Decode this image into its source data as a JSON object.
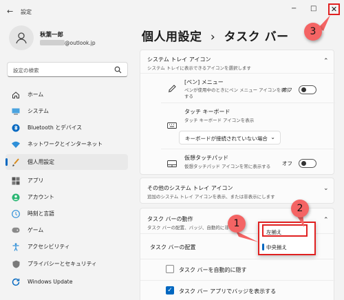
{
  "window": {
    "title": "設定",
    "back_glyph": "←",
    "minimize_glyph": "−",
    "maximize_glyph": "□",
    "close_glyph": "✕"
  },
  "profile": {
    "name": "秋葉一郎",
    "email_suffix": "@outlook.jp"
  },
  "search": {
    "placeholder": "設定の検索"
  },
  "nav": [
    {
      "label": "ホーム",
      "icon": "home-icon"
    },
    {
      "label": "システム",
      "icon": "system-icon"
    },
    {
      "label": "Bluetooth とデバイス",
      "icon": "bluetooth-icon"
    },
    {
      "label": "ネットワークとインターネット",
      "icon": "wifi-icon"
    },
    {
      "label": "個人用設定",
      "icon": "brush-icon",
      "selected": true
    },
    {
      "label": "アプリ",
      "icon": "apps-icon"
    },
    {
      "label": "アカウント",
      "icon": "account-icon"
    },
    {
      "label": "時刻と言語",
      "icon": "globe-icon"
    },
    {
      "label": "ゲーム",
      "icon": "gamepad-icon"
    },
    {
      "label": "アクセシビリティ",
      "icon": "accessibility-icon"
    },
    {
      "label": "プライバシーとセキュリティ",
      "icon": "shield-icon"
    },
    {
      "label": "Windows Update",
      "icon": "update-icon"
    }
  ],
  "breadcrumb": {
    "parent": "個人用設定",
    "separator": "›",
    "current": "タスク バー"
  },
  "tray_icons": {
    "title": "システム トレイ アイコン",
    "subtitle": "システム トレイに表示できるアイコンを選択します",
    "pen": {
      "title": "[ペン] メニュー",
      "subtitle1": "ペンが使用中のときにペン メニュー アイコンを表示",
      "subtitle2": "する",
      "state": "オフ"
    },
    "keyboard": {
      "title": "タッチ キーボード",
      "subtitle": "タッチ キーボード アイコンを表示",
      "dropdown": "キーボードが接続されていない場合"
    },
    "touchpad": {
      "title": "仮想タッチパッド",
      "subtitle": "仮想タッチパッド アイコンを常に表示する",
      "state": "オフ"
    }
  },
  "other_tray": {
    "title": "その他のシステム トレイ アイコン",
    "subtitle": "追加のシステム トレイ アイコンを表示、または非表示にします"
  },
  "behavior": {
    "title": "タスク バーの動作",
    "subtitle": "タスク バーの配置、バッジ、自動的に非",
    "alignment_label": "タスク バーの配置",
    "autohide_label": "タスク バーを自動的に隠す",
    "badges_label": "タスク バー アプリでバッジを表示する",
    "check_glyph": "✓"
  },
  "alignment_popup": {
    "options": [
      "左揃え",
      "中央揃え"
    ],
    "selected": "中央揃え"
  },
  "callouts": [
    "1",
    "2",
    "3"
  ],
  "colors": {
    "accent": "#0067c0",
    "annotation": "#e02020",
    "callout": "#f46464"
  }
}
